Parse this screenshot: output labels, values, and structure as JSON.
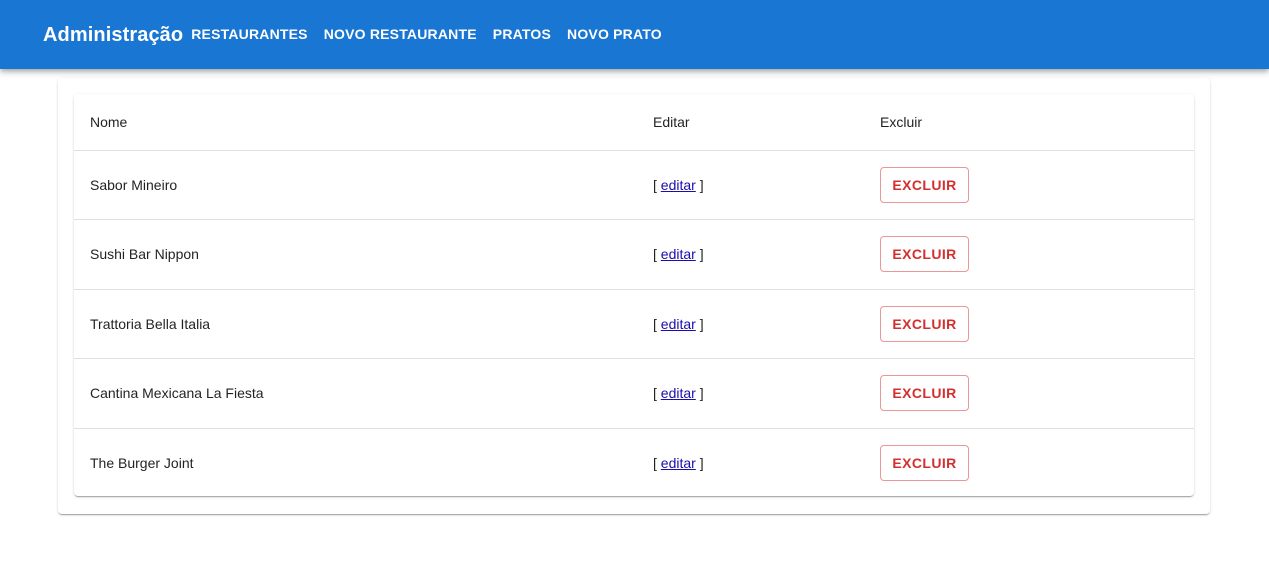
{
  "appbar": {
    "title": "Administração",
    "nav": [
      {
        "label": "Restaurantes"
      },
      {
        "label": "Novo Restaurante"
      },
      {
        "label": "Pratos"
      },
      {
        "label": "Novo Prato"
      }
    ]
  },
  "table": {
    "headers": {
      "nome": "Nome",
      "editar": "Editar",
      "excluir": "Excluir"
    },
    "edit_prefix": "[ ",
    "edit_label": "editar",
    "edit_suffix": " ]",
    "delete_label": "Excluir",
    "rows": [
      {
        "nome": "Sabor Mineiro"
      },
      {
        "nome": "Sushi Bar Nippon"
      },
      {
        "nome": "Trattoria Bella Italia"
      },
      {
        "nome": "Cantina Mexicana La Fiesta"
      },
      {
        "nome": "The Burger Joint"
      }
    ]
  },
  "colors": {
    "appbar": "#1976d2",
    "danger": "#d32f2f",
    "link": "#1a0dab"
  }
}
